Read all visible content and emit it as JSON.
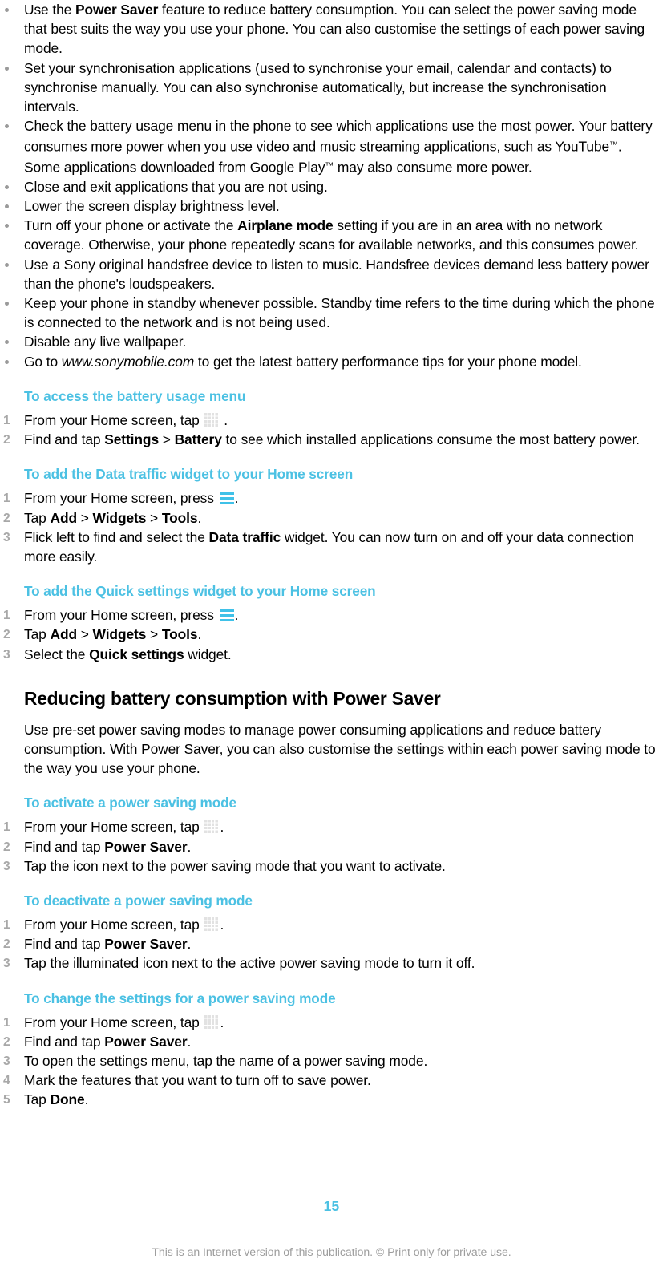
{
  "document": {
    "page_number": "15",
    "footer_note": "This is an Internet version of this publication. © Print only for private use.",
    "accent_color": "#4cc1e3",
    "bullet_color": "#9a9a9a",
    "step_number_color": "#a8a8a8"
  },
  "tips": {
    "items": [
      {
        "parts": [
          {
            "t": "Use the ",
            "s": "normal"
          },
          {
            "t": "Power Saver",
            "s": "bold"
          },
          {
            "t": " feature to reduce battery consumption. You can select the power saving mode that best suits the way you use your phone. You can also customise the settings of each power saving mode.",
            "s": "normal"
          }
        ]
      },
      {
        "parts": [
          {
            "t": "Set your synchronisation applications (used to synchronise your email, calendar and contacts) to synchronise manually. You can also synchronise automatically, but increase the synchronisation intervals.",
            "s": "normal"
          }
        ]
      },
      {
        "parts": [
          {
            "t": "Check the battery usage menu in the phone to see which applications use the most power. Your battery consumes more power when you use video and music streaming applications, such as YouTube",
            "s": "normal"
          },
          {
            "t": "™",
            "s": "sup"
          },
          {
            "t": ". Some applications downloaded from Google Play",
            "s": "normal"
          },
          {
            "t": "™",
            "s": "sup"
          },
          {
            "t": " may also consume more power.",
            "s": "normal"
          }
        ]
      },
      {
        "parts": [
          {
            "t": "Close and exit applications that you are not using.",
            "s": "normal"
          }
        ]
      },
      {
        "parts": [
          {
            "t": "Lower the screen display brightness level.",
            "s": "normal"
          }
        ]
      },
      {
        "parts": [
          {
            "t": "Turn off your phone or activate the ",
            "s": "normal"
          },
          {
            "t": "Airplane mode",
            "s": "bold"
          },
          {
            "t": " setting if you are in an area with no network coverage. Otherwise, your phone repeatedly scans for available networks, and this consumes power.",
            "s": "normal"
          }
        ]
      },
      {
        "parts": [
          {
            "t": "Use a Sony original handsfree device to listen to music. Handsfree devices demand less battery power than the phone's loudspeakers.",
            "s": "normal"
          }
        ]
      },
      {
        "parts": [
          {
            "t": "Keep your phone in standby whenever possible. Standby time refers to the time during which the phone is connected to the network and is not being used.",
            "s": "normal"
          }
        ]
      },
      {
        "parts": [
          {
            "t": "Disable any live wallpaper.",
            "s": "normal"
          }
        ]
      },
      {
        "parts": [
          {
            "t": "Go to ",
            "s": "normal"
          },
          {
            "t": "www.sonymobile.com",
            "s": "italic"
          },
          {
            "t": " to get the latest battery performance tips for your phone model.",
            "s": "normal"
          }
        ]
      }
    ]
  },
  "sections": [
    {
      "kind": "procedure",
      "heading": "To access the battery usage menu",
      "steps": [
        {
          "parts": [
            {
              "t": "From your Home screen, tap ",
              "s": "normal"
            },
            {
              "t": "app-grid-icon",
              "s": "icon-app-grid"
            },
            {
              "t": " .",
              "s": "normal"
            }
          ]
        },
        {
          "parts": [
            {
              "t": "Find and tap ",
              "s": "normal"
            },
            {
              "t": "Settings",
              "s": "bold"
            },
            {
              "t": " > ",
              "s": "normal"
            },
            {
              "t": "Battery",
              "s": "bold"
            },
            {
              "t": " to see which installed applications consume the most battery power.",
              "s": "normal"
            }
          ]
        }
      ]
    },
    {
      "kind": "procedure",
      "heading": "To add the Data traffic widget to your Home screen",
      "steps": [
        {
          "parts": [
            {
              "t": "From your Home screen, press ",
              "s": "normal"
            },
            {
              "t": "menu-icon",
              "s": "icon-menu"
            },
            {
              "t": ".",
              "s": "normal"
            }
          ]
        },
        {
          "parts": [
            {
              "t": "Tap ",
              "s": "normal"
            },
            {
              "t": "Add",
              "s": "bold"
            },
            {
              "t": " > ",
              "s": "normal"
            },
            {
              "t": "Widgets",
              "s": "bold"
            },
            {
              "t": " > ",
              "s": "normal"
            },
            {
              "t": "Tools",
              "s": "bold"
            },
            {
              "t": ".",
              "s": "normal"
            }
          ]
        },
        {
          "parts": [
            {
              "t": "Flick left to find and select the ",
              "s": "normal"
            },
            {
              "t": "Data traffic",
              "s": "bold"
            },
            {
              "t": " widget. You can now turn on and off your data connection more easily.",
              "s": "normal"
            }
          ]
        }
      ]
    },
    {
      "kind": "procedure",
      "heading": "To add the Quick settings widget to your Home screen",
      "steps": [
        {
          "parts": [
            {
              "t": "From your Home screen, press ",
              "s": "normal"
            },
            {
              "t": "menu-icon",
              "s": "icon-menu"
            },
            {
              "t": ".",
              "s": "normal"
            }
          ]
        },
        {
          "parts": [
            {
              "t": "Tap ",
              "s": "normal"
            },
            {
              "t": "Add",
              "s": "bold"
            },
            {
              "t": " > ",
              "s": "normal"
            },
            {
              "t": "Widgets",
              "s": "bold"
            },
            {
              "t": " > ",
              "s": "normal"
            },
            {
              "t": "Tools",
              "s": "bold"
            },
            {
              "t": ".",
              "s": "normal"
            }
          ]
        },
        {
          "parts": [
            {
              "t": "Select the ",
              "s": "normal"
            },
            {
              "t": "Quick settings",
              "s": "bold"
            },
            {
              "t": " widget.",
              "s": "normal"
            }
          ]
        }
      ]
    },
    {
      "kind": "topic",
      "heading": "Reducing battery consumption with Power Saver",
      "paragraph": [
        {
          "t": "Use pre-set power saving modes to manage power consuming applications and reduce battery consumption. With Power Saver, you can also customise the settings within each power saving mode to the way you use your phone.",
          "s": "normal"
        }
      ]
    },
    {
      "kind": "procedure",
      "heading": "To activate a power saving mode",
      "steps": [
        {
          "parts": [
            {
              "t": "From your Home screen, tap ",
              "s": "normal"
            },
            {
              "t": "app-grid-icon",
              "s": "icon-app-grid"
            },
            {
              "t": ".",
              "s": "normal"
            }
          ]
        },
        {
          "parts": [
            {
              "t": "Find and tap ",
              "s": "normal"
            },
            {
              "t": "Power Saver",
              "s": "bold"
            },
            {
              "t": ".",
              "s": "normal"
            }
          ]
        },
        {
          "parts": [
            {
              "t": "Tap the icon next to the power saving mode that you want to activate.",
              "s": "normal"
            }
          ]
        }
      ]
    },
    {
      "kind": "procedure",
      "heading": "To deactivate a power saving mode",
      "steps": [
        {
          "parts": [
            {
              "t": "From your Home screen, tap ",
              "s": "normal"
            },
            {
              "t": "app-grid-icon",
              "s": "icon-app-grid"
            },
            {
              "t": ".",
              "s": "normal"
            }
          ]
        },
        {
          "parts": [
            {
              "t": "Find and tap ",
              "s": "normal"
            },
            {
              "t": "Power Saver",
              "s": "bold"
            },
            {
              "t": ".",
              "s": "normal"
            }
          ]
        },
        {
          "parts": [
            {
              "t": "Tap the illuminated icon next to the active power saving mode to turn it off.",
              "s": "normal"
            }
          ]
        }
      ]
    },
    {
      "kind": "procedure",
      "heading": "To change the settings for a power saving mode",
      "steps": [
        {
          "parts": [
            {
              "t": "From your Home screen, tap ",
              "s": "normal"
            },
            {
              "t": "app-grid-icon",
              "s": "icon-app-grid"
            },
            {
              "t": ".",
              "s": "normal"
            }
          ]
        },
        {
          "parts": [
            {
              "t": "Find and tap ",
              "s": "normal"
            },
            {
              "t": "Power Saver",
              "s": "bold"
            },
            {
              "t": ".",
              "s": "normal"
            }
          ]
        },
        {
          "parts": [
            {
              "t": "To open the settings menu, tap the name of a power saving mode.",
              "s": "normal"
            }
          ]
        },
        {
          "parts": [
            {
              "t": "Mark the features that you want to turn off to save power.",
              "s": "normal"
            }
          ]
        },
        {
          "parts": [
            {
              "t": "Tap ",
              "s": "normal"
            },
            {
              "t": "Done",
              "s": "bold"
            },
            {
              "t": ".",
              "s": "normal"
            }
          ]
        }
      ]
    }
  ]
}
